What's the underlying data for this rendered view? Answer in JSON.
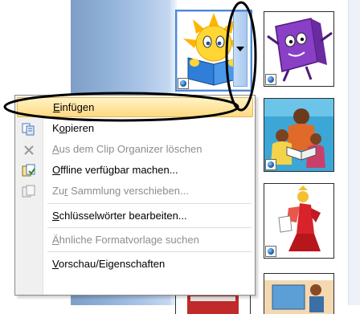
{
  "context_menu": {
    "items": [
      {
        "pre": "",
        "key": "E",
        "post": "infügen",
        "icon": "",
        "disabled": false,
        "hovered": true
      },
      {
        "pre": "K",
        "key": "o",
        "post": "pieren",
        "icon": "copy-icon",
        "disabled": false
      },
      {
        "pre": "",
        "key": "A",
        "post": "us dem Clip Organizer löschen",
        "icon": "delete-icon",
        "disabled": true
      },
      {
        "pre": "",
        "key": "O",
        "post": "ffline verfügbar machen...",
        "icon": "make-offline-icon",
        "disabled": false
      },
      {
        "pre": "Zu",
        "key": "r",
        "post": " Sammlung verschieben...",
        "icon": "move-to-collection-icon",
        "disabled": true
      },
      {
        "pre": "",
        "key": "S",
        "post": "chlüsselwörter bearbeiten...",
        "icon": "",
        "disabled": false
      },
      {
        "pre": "",
        "key": "Ä",
        "post": "hnliche Formatvorlage suchen",
        "icon": "",
        "disabled": true
      },
      {
        "pre": "",
        "key": "V",
        "post": "orschau/Eigenschaften",
        "icon": "",
        "disabled": false
      }
    ]
  },
  "clip_gallery": {
    "thumbnails": [
      "reading-sun-clip",
      "purple-book-character-clip",
      "family-reading-clip",
      "red-figure-clip",
      "reading-book-clip",
      "desk-clip"
    ]
  },
  "colors": {
    "highlight_top": "#fff3c4",
    "highlight_bottom": "#ffd982",
    "annotation": "#000000",
    "selection": "#4f87d6"
  }
}
